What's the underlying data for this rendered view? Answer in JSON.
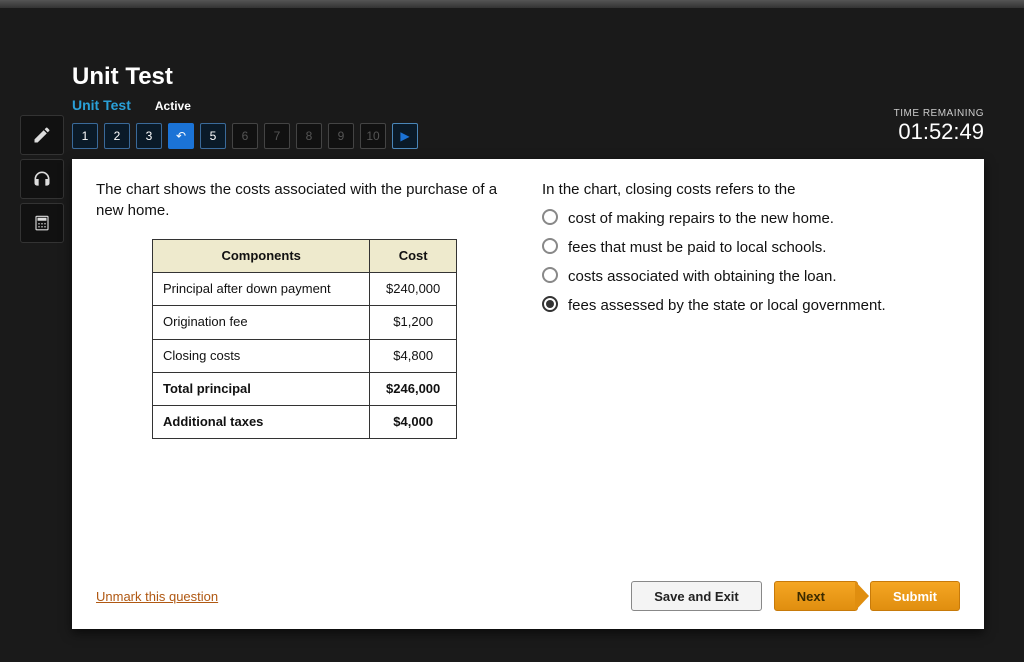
{
  "header": {
    "title": "Unit Test",
    "subtitle_primary": "Unit Test",
    "subtitle_secondary": "Active"
  },
  "timer": {
    "label": "TIME REMAINING",
    "value": "01:52:49"
  },
  "nav": {
    "items": [
      "1",
      "2",
      "3",
      "↶",
      "5",
      "6",
      "7",
      "8",
      "9",
      "10",
      "▶"
    ],
    "current_index": 3,
    "disabled_start": 5,
    "play_index": 10
  },
  "question": {
    "intro": "The chart shows the costs associated with the purchase of a new home.",
    "prompt": "In the chart, closing costs refers to the",
    "table": {
      "headers": [
        "Components",
        "Cost"
      ],
      "rows": [
        {
          "label": "Principal after down payment",
          "cost": "$240,000",
          "bold": false
        },
        {
          "label": "Origination fee",
          "cost": "$1,200",
          "bold": false
        },
        {
          "label": "Closing costs",
          "cost": "$4,800",
          "bold": false
        },
        {
          "label": "Total principal",
          "cost": "$246,000",
          "bold": true
        },
        {
          "label": "Additional taxes",
          "cost": "$4,000",
          "bold": true
        }
      ]
    },
    "options": [
      "cost of making repairs to the new home.",
      "fees that must be paid to local schools.",
      "costs associated with obtaining the loan.",
      "fees assessed by the state or local government."
    ],
    "selected_index": 3
  },
  "footer": {
    "unmark": "Unmark this question",
    "save": "Save and Exit",
    "next": "Next",
    "submit": "Submit"
  },
  "chart_data": {
    "type": "table",
    "title": "Costs associated with the purchase of a new home",
    "columns": [
      "Components",
      "Cost (USD)"
    ],
    "rows": [
      [
        "Principal after down payment",
        240000
      ],
      [
        "Origination fee",
        1200
      ],
      [
        "Closing costs",
        4800
      ],
      [
        "Total principal",
        246000
      ],
      [
        "Additional taxes",
        4000
      ]
    ]
  }
}
